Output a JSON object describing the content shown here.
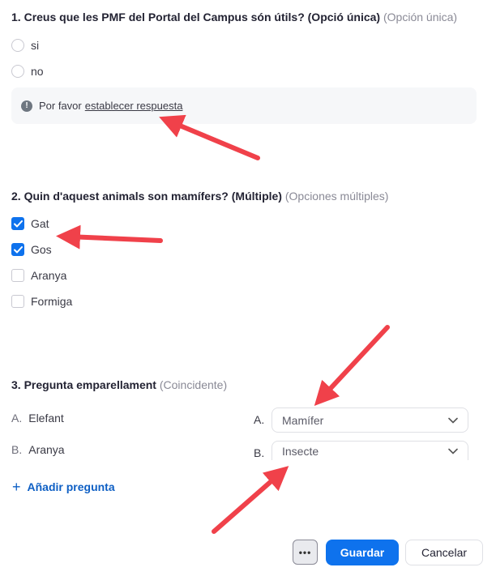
{
  "q1": {
    "number": "1.",
    "title": "Creus que les PMF del Portal del Campus són útils? (Opció única)",
    "type": "(Opción única)",
    "options": [
      "si",
      "no"
    ],
    "warning": {
      "text": "Por favor",
      "link": "establecer respuesta",
      "icon": "exclamation-icon"
    }
  },
  "q2": {
    "number": "2.",
    "title": "Quin d'aquest animals son mamífers? (Múltiple)",
    "type": "(Opciones múltiples)",
    "options": [
      {
        "label": "Gat",
        "checked": true
      },
      {
        "label": "Gos",
        "checked": true
      },
      {
        "label": "Aranya",
        "checked": false
      },
      {
        "label": "Formiga",
        "checked": false
      }
    ]
  },
  "q3": {
    "number": "3.",
    "title": "Pregunta emparellament",
    "type": "(Coincidente)",
    "pairs": [
      {
        "letter": "A.",
        "item": "Elefant",
        "match_letter": "A.",
        "selected": "Mamífer"
      },
      {
        "letter": "B.",
        "item": "Aranya",
        "match_letter": "B.",
        "selected": "Insecte"
      }
    ]
  },
  "add_question": "Añadir pregunta",
  "footer": {
    "more": "•••",
    "save": "Guardar",
    "cancel": "Cancelar"
  },
  "colors": {
    "primary": "#0e72ed",
    "annotation_arrow": "#f0414a"
  }
}
